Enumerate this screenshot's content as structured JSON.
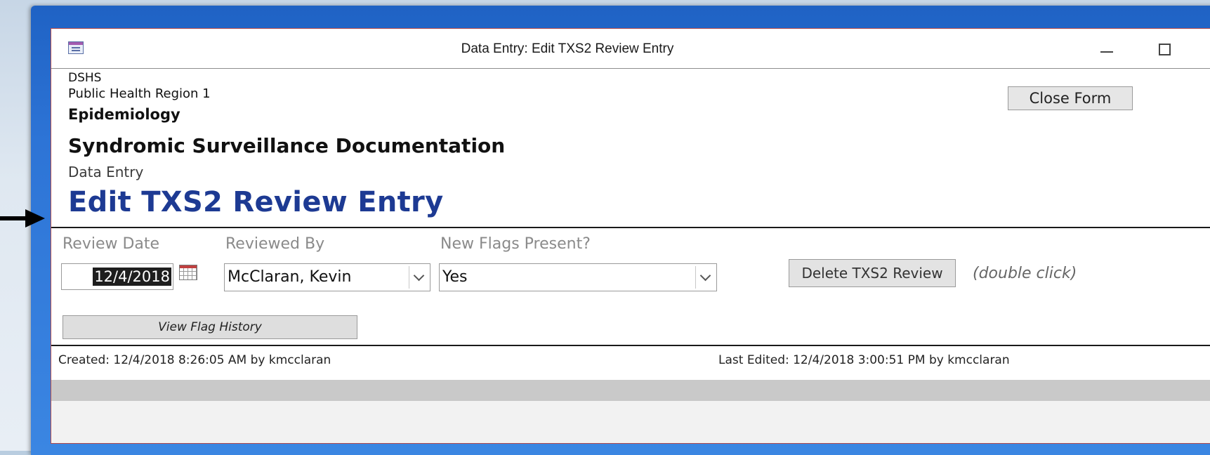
{
  "window": {
    "title": "Data Entry: Edit TXS2 Review Entry",
    "minimize_icon": "minimize-icon",
    "maximize_icon": "maximize-icon",
    "close_glyph": "✕"
  },
  "header": {
    "org": "DSHS",
    "region": "Public Health Region 1",
    "department": "Epidemiology",
    "system": "Syndromic Surveillance Documentation",
    "section": "Data Entry",
    "form_title": "Edit TXS2 Review Entry",
    "close_form_label": "Close Form",
    "form_title_color": "#1d3a93"
  },
  "fields": {
    "review_date_label": "Review Date",
    "review_date_value": "12/4/2018",
    "reviewed_by_label": "Reviewed By",
    "reviewed_by_value": "McClaran, Kevin",
    "new_flags_label": "New Flags Present?",
    "new_flags_value": "Yes"
  },
  "actions": {
    "delete_label": "Delete TXS2 Review",
    "delete_hint": "(double click)",
    "view_history_label": "View Flag History"
  },
  "footer": {
    "created": "Created: 12/4/2018 8:26:05 AM by kmcclaran",
    "last_edited": "Last Edited: 12/4/2018 3:00:51 PM by kmcclaran"
  },
  "icons": {
    "app": "form-icon",
    "calendar": "calendar-icon",
    "dropdown": "chevron-down-icon",
    "pointer": "arrow-right-icon"
  }
}
